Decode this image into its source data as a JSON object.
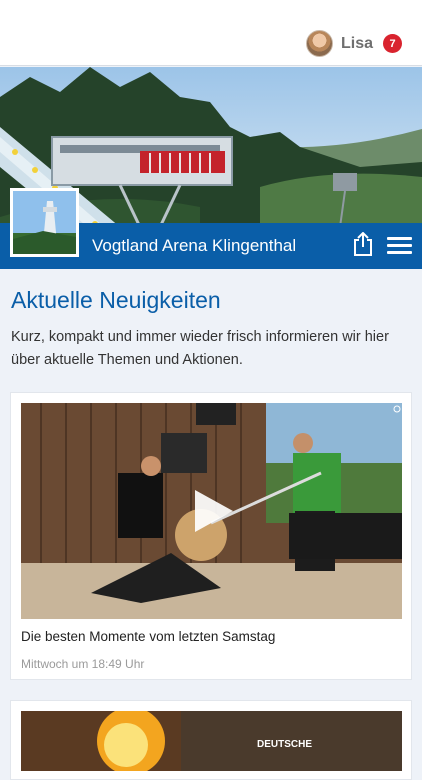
{
  "user": {
    "name": "Lisa",
    "notifications": "7"
  },
  "venue": {
    "title": "Vogtland Arena Klingenthal"
  },
  "news": {
    "title": "Aktuelle Neuigkeiten",
    "intro": "Kurz, kompakt und immer wieder frisch informieren wir hier über aktuelle Themen und Aktionen.",
    "items": [
      {
        "title": "Die besten Momente vom letzten Samstag",
        "time": "Mittwoch um 18:49 Uhr",
        "media_type": "video"
      },
      {
        "partial_text": "DEUTSCHE"
      }
    ]
  },
  "icons": {
    "share": "share-icon",
    "menu": "hamburger-menu-icon",
    "play": "play-icon"
  },
  "colors": {
    "brand_blue": "#0a5ea8",
    "badge_red": "#d9232e"
  }
}
